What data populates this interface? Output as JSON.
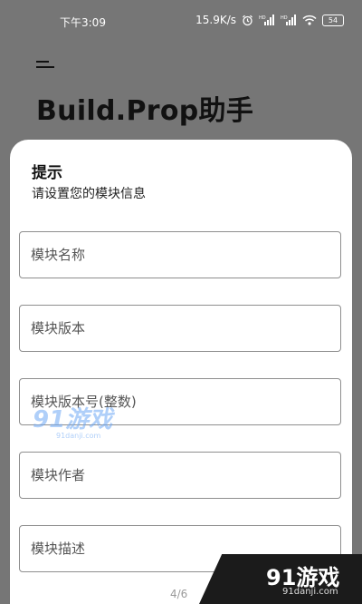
{
  "status_bar": {
    "time": "下午3:09",
    "network_speed": "15.9K/s",
    "battery_level": "54",
    "icons": [
      "alarm-icon",
      "signal-hd-icon",
      "signal-hd-icon",
      "wifi-icon",
      "battery-icon"
    ]
  },
  "app": {
    "title": "Build.Prop助手",
    "menu_icon": "menu-icon"
  },
  "dialog": {
    "title": "提示",
    "message": "请设置您的模块信息",
    "fields": [
      {
        "placeholder": "模块名称",
        "value": ""
      },
      {
        "placeholder": "模块版本",
        "value": ""
      },
      {
        "placeholder": "模块版本号(整数)",
        "value": ""
      },
      {
        "placeholder": "模块作者",
        "value": ""
      },
      {
        "placeholder": "模块描述",
        "value": ""
      }
    ]
  },
  "overlay": {
    "page_indicator": "4/6",
    "watermark_center": "91游戏",
    "watermark_center_sub": "91danji.com",
    "corner_badge": "91游戏",
    "corner_badge_sub": "91danji.com"
  },
  "colors": {
    "dim_background": "#767676",
    "dialog_background": "#ffffff",
    "field_border": "#8e8e8e",
    "watermark_blue": "#6fa8f5"
  }
}
